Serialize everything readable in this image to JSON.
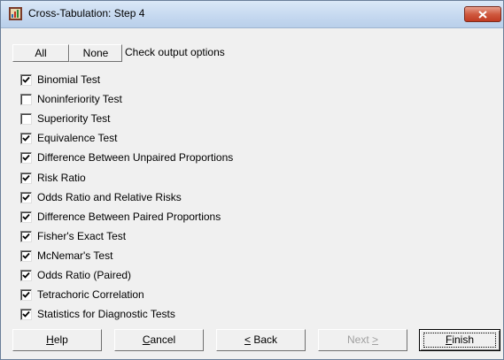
{
  "window": {
    "title": "Cross-Tabulation: Step 4"
  },
  "top_bar": {
    "all_label": "All",
    "none_label": "None",
    "hint": "Check output options"
  },
  "options": [
    {
      "label": "Binomial Test",
      "checked": true
    },
    {
      "label": "Noninferiority Test",
      "checked": false
    },
    {
      "label": "Superiority Test",
      "checked": false
    },
    {
      "label": "Equivalence Test",
      "checked": true
    },
    {
      "label": "Difference Between Unpaired Proportions",
      "checked": true
    },
    {
      "label": "Risk Ratio",
      "checked": true
    },
    {
      "label": "Odds Ratio and Relative Risks",
      "checked": true
    },
    {
      "label": "Difference Between Paired Proportions",
      "checked": true
    },
    {
      "label": "Fisher's Exact Test",
      "checked": true
    },
    {
      "label": "McNemar's Test",
      "checked": true
    },
    {
      "label": "Odds Ratio (Paired)",
      "checked": true
    },
    {
      "label": "Tetrachoric Correlation",
      "checked": true
    },
    {
      "label": "Statistics for Diagnostic Tests",
      "checked": true
    }
  ],
  "buttons": {
    "help": {
      "pre": "",
      "accel": "H",
      "post": "elp"
    },
    "cancel": {
      "pre": "",
      "accel": "C",
      "post": "ancel"
    },
    "back": {
      "pre": "",
      "accel": "<",
      "post": " Back"
    },
    "next": {
      "pre": "Next ",
      "accel": ">",
      "post": ""
    },
    "finish": {
      "pre": "",
      "accel": "F",
      "post": "inish"
    }
  },
  "colors": {
    "title_gradient": "#c6d9f0",
    "close_button": "#c13b22",
    "dialog_background": "#f0f0f0",
    "disabled_text": "#a0a0a0"
  },
  "icons": {
    "app": "app-icon",
    "close": "close-icon",
    "check": "checkmark-icon"
  }
}
